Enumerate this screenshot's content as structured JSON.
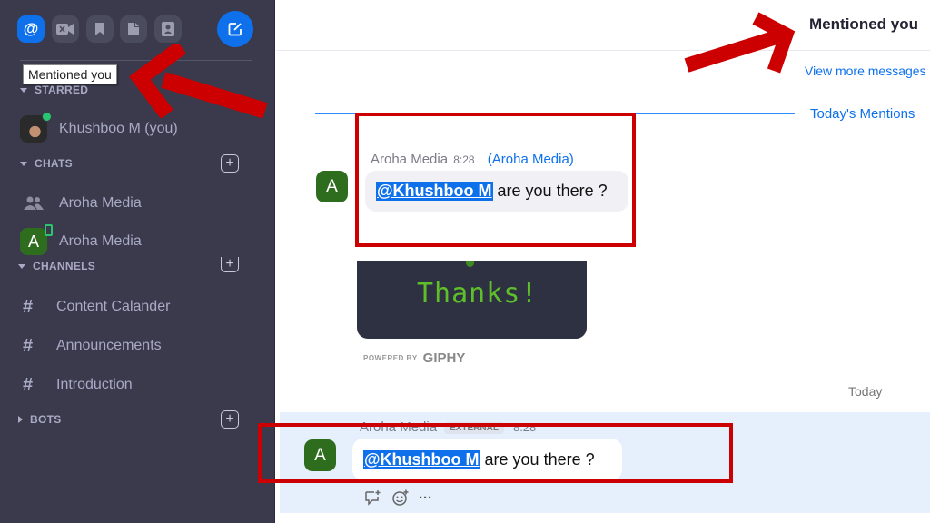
{
  "sidebar": {
    "top_buttons": [
      {
        "icon": "at-icon",
        "active": true
      },
      {
        "icon": "video-off-icon",
        "active": false
      },
      {
        "icon": "bookmark-icon",
        "active": false
      },
      {
        "icon": "file-icon",
        "active": false
      },
      {
        "icon": "contact-icon",
        "active": false
      }
    ],
    "compose_icon": "compose-icon",
    "tooltip": "Mentioned you",
    "starred": {
      "label": "STARRED",
      "items": [
        {
          "label": "Khushboo M (you)",
          "status": "online"
        }
      ]
    },
    "chats": {
      "label": "CHATS",
      "items": [
        {
          "label": "Aroha Media",
          "icon": "group-icon"
        },
        {
          "label": "Aroha Media",
          "avatar_letter": "A"
        }
      ]
    },
    "channels": {
      "label": "CHANNELS",
      "items": [
        {
          "label": "Content Calander"
        },
        {
          "label": "Announcements"
        },
        {
          "label": "Introduction"
        }
      ]
    },
    "bots": {
      "label": "BOTS"
    }
  },
  "main": {
    "title": "Mentioned you",
    "view_more": "View more messages",
    "todays_mentions": "Today's Mentions",
    "message1": {
      "avatar_letter": "A",
      "sender": "Aroha Media",
      "time": "8:28",
      "channel": "(Aroha Media)",
      "mention": "@Khushboo M",
      "text": "are you there ?"
    },
    "gif": {
      "text": "Thanks!",
      "powered_by": "POWERED BY",
      "provider": "GIPHY"
    },
    "date_label": "Today",
    "message2": {
      "avatar_letter": "A",
      "sender": "Aroha Media",
      "badge": "EXTERNAL",
      "time": "8:28",
      "mention": "@Khushboo M",
      "text": "are you there ?"
    },
    "message_actions": [
      "reply-icon",
      "emoji-reaction-icon",
      "more-icon"
    ],
    "more_label": "···"
  },
  "colors": {
    "accent": "#0e71eb",
    "sidebar_bg": "#3a3a4c",
    "annotation": "#cc0000",
    "highlight_row": "#e6effc"
  }
}
